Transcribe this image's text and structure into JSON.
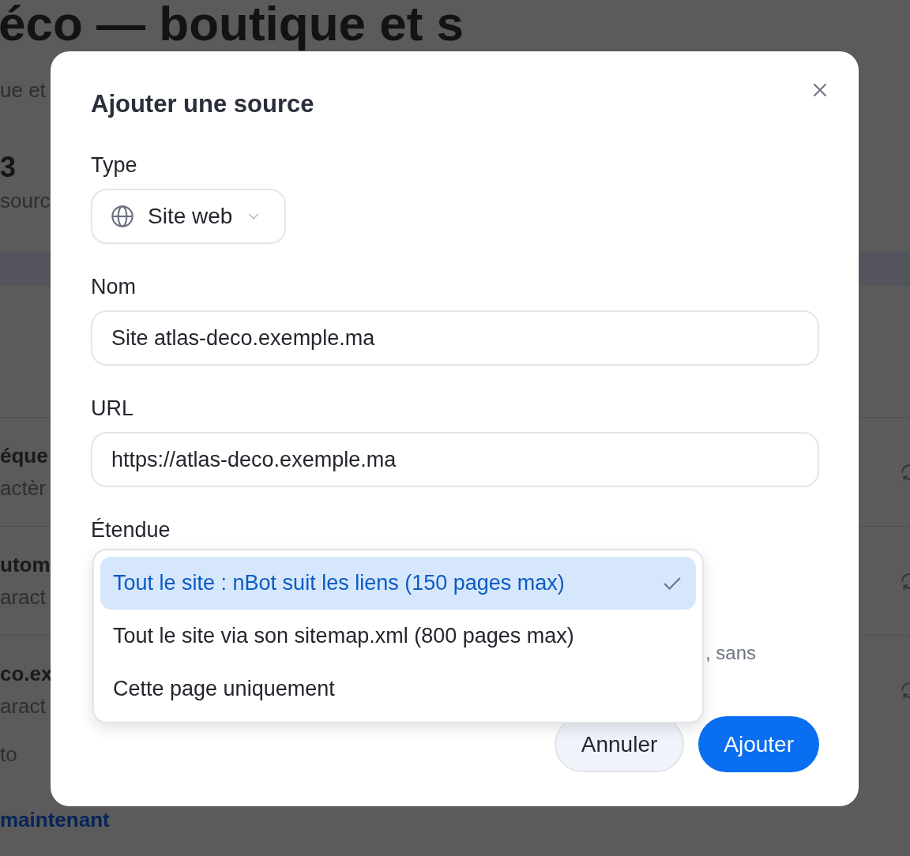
{
  "background_page": {
    "title": "éco — boutique et s",
    "subtitle": "ue et",
    "stat_value": "3",
    "stat_label": "sourc",
    "rows": [
      {
        "name": "éque",
        "detail": "actèr"
      },
      {
        "name": "utom",
        "detail": "aract"
      },
      {
        "name": "co.ex",
        "detail": "aract"
      }
    ],
    "footer_text": "to",
    "link": "maintenant"
  },
  "dialog": {
    "title": "Ajouter une source",
    "type_label": "Type",
    "type_value": "Site web",
    "name_label": "Nom",
    "name_value": "Site atlas-deco.exemple.ma",
    "url_label": "URL",
    "url_value": "https://atlas-deco.exemple.ma",
    "scope_label": "Étendue",
    "scope_help": ", sans",
    "scope_options": [
      {
        "label": "Tout le site : nBot suit les liens (150 pages max)",
        "selected": true
      },
      {
        "label": "Tout le site via son sitemap.xml (800 pages max)",
        "selected": false
      },
      {
        "label": "Cette page uniquement",
        "selected": false
      }
    ],
    "buttons": [
      {
        "label": "Annuler",
        "kind": "secondary"
      },
      {
        "label": "Ajouter",
        "kind": "primary"
      }
    ]
  }
}
